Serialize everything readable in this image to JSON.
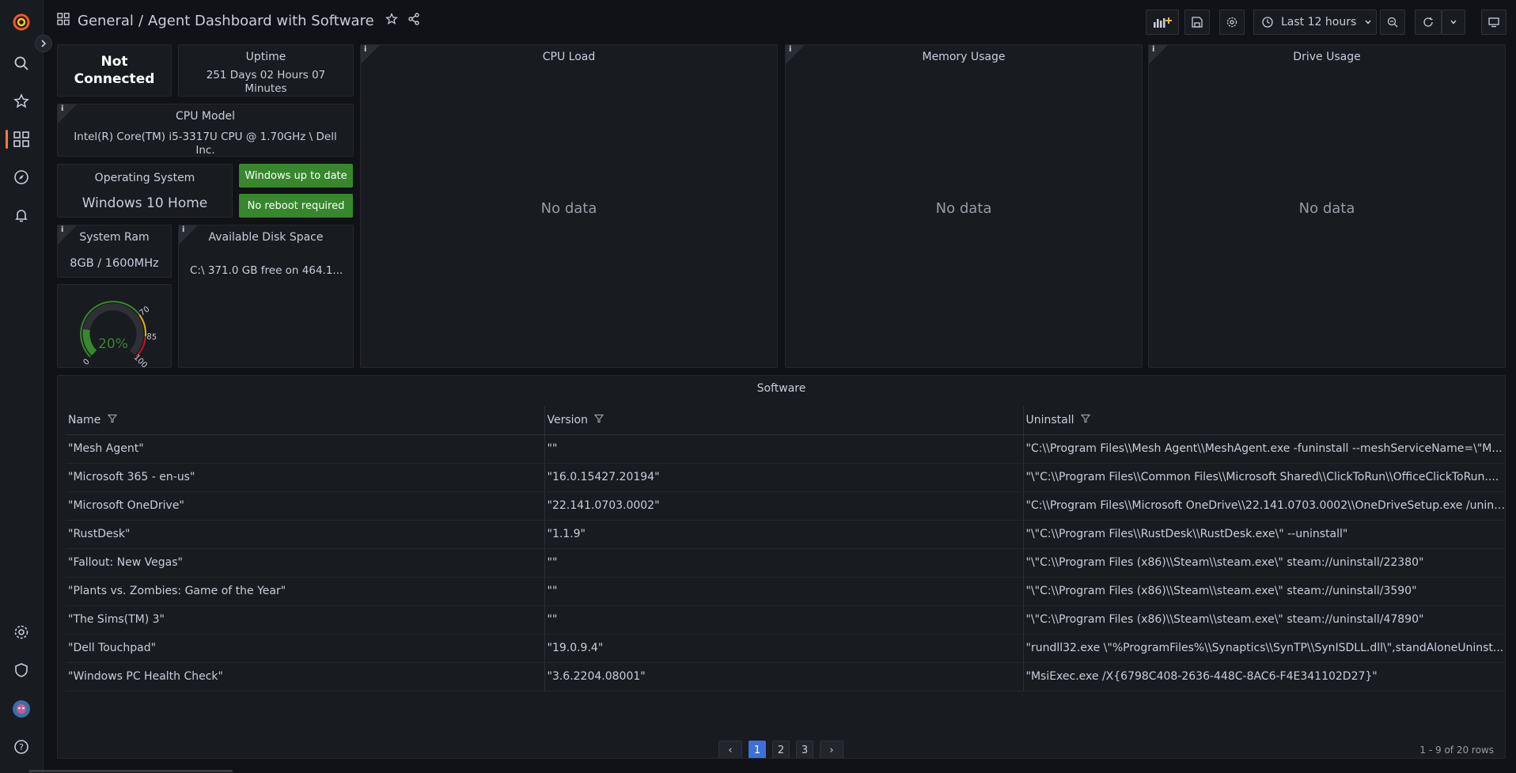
{
  "breadcrumb": {
    "folder": "General",
    "separator": "/",
    "title": "Agent Dashboard with Software"
  },
  "time_picker": {
    "label": "Last 12 hours"
  },
  "panels": {
    "connection": {
      "value": "Not Connected"
    },
    "uptime": {
      "title": "Uptime",
      "value": "251 Days 02 Hours 07 Minutes"
    },
    "cpu_model": {
      "title": "CPU Model",
      "value": "Intel(R) Core(TM) i5-3317U CPU @ 1.70GHz \\ Dell Inc."
    },
    "os": {
      "title": "Operating System",
      "value": "Windows 10 Home"
    },
    "win_update": {
      "value": "Windows up to date"
    },
    "reboot": {
      "value": "No reboot required"
    },
    "ram": {
      "title": "System Ram",
      "value": "8GB / 1600MHz"
    },
    "disk": {
      "title": "Available Disk Space",
      "value": "C:\\ 371.0 GB free on 464.1..."
    },
    "gauge": {
      "value": "20%",
      "percent": 20,
      "ticks": [
        "0",
        "70",
        "85",
        "100"
      ]
    },
    "cpu_load": {
      "title": "CPU Load",
      "nodata": "No data"
    },
    "memory": {
      "title": "Memory Usage",
      "nodata": "No data"
    },
    "drive": {
      "title": "Drive Usage",
      "nodata": "No data"
    },
    "info_glyph": "i"
  },
  "software": {
    "title": "Software",
    "columns": [
      "Name",
      "Version",
      "Uninstall"
    ],
    "rows": [
      [
        "\"Mesh Agent\"",
        "\"\"",
        "\"C:\\\\Program Files\\\\Mesh Agent\\\\MeshAgent.exe -funinstall --meshServiceName=\\\"M..."
      ],
      [
        "\"Microsoft 365 - en-us\"",
        "\"16.0.15427.20194\"",
        "\"\\\"C:\\\\Program Files\\\\Common Files\\\\Microsoft Shared\\\\ClickToRun\\\\OfficeClickToRun...."
      ],
      [
        "\"Microsoft OneDrive\"",
        "\"22.141.0703.0002\"",
        "\"C:\\\\Program Files\\\\Microsoft OneDrive\\\\22.141.0703.0002\\\\OneDriveSetup.exe /unins..."
      ],
      [
        "\"RustDesk\"",
        "\"1.1.9\"",
        "\"\\\"C:\\\\Program Files\\\\RustDesk\\\\RustDesk.exe\\\" --uninstall\""
      ],
      [
        "\"Fallout: New Vegas\"",
        "\"\"",
        "\"\\\"C:\\\\Program Files (x86)\\\\Steam\\\\steam.exe\\\" steam://uninstall/22380\""
      ],
      [
        "\"Plants vs. Zombies: Game of the Year\"",
        "\"\"",
        "\"\\\"C:\\\\Program Files (x86)\\\\Steam\\\\steam.exe\\\" steam://uninstall/3590\""
      ],
      [
        "\"The Sims(TM) 3\"",
        "\"\"",
        "\"\\\"C:\\\\Program Files (x86)\\\\Steam\\\\steam.exe\\\" steam://uninstall/47890\""
      ],
      [
        "\"Dell Touchpad\"",
        "\"19.0.9.4\"",
        "\"rundll32.exe \\\"%ProgramFiles%\\\\Synaptics\\\\SynTP\\\\SynISDLL.dll\\\",standAloneUninst..."
      ],
      [
        "\"Windows PC Health Check\"",
        "\"3.6.2204.08001\"",
        "\"MsiExec.exe /X{6798C408-2636-448C-8AC6-F4E341102D27}\""
      ]
    ],
    "pagination": {
      "prev": "‹",
      "pages": [
        "1",
        "2",
        "3"
      ],
      "next": "›",
      "active_page": "1"
    },
    "row_count": "1 - 9 of 20 rows"
  },
  "colors": {
    "accent": "#ff7941",
    "green": "#37872d",
    "page_active": "#3d71d9"
  }
}
